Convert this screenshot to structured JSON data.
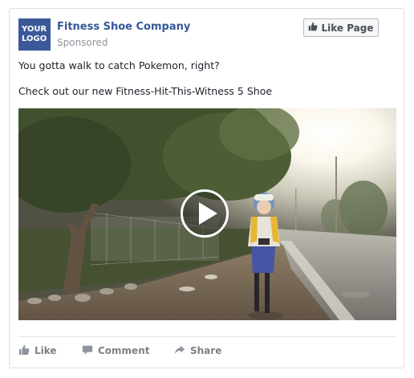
{
  "post": {
    "logo_line1": "YOUR",
    "logo_line2": "LOGO",
    "page_name": "Fitness Shoe Company",
    "sponsored": "Sponsored",
    "like_page": "Like Page",
    "text_line1": "You gotta walk to catch Pokemon, right?",
    "text_line2": "Check out our new Fitness-Hit-This-Witness 5 Shoe"
  },
  "actions": {
    "like": "Like",
    "comment": "Comment",
    "share": "Share"
  },
  "colors": {
    "brand_blue": "#3b5998",
    "link_blue": "#365899",
    "muted_gray": "#90949c",
    "action_gray": "#7f7f7f"
  },
  "icons": [
    "thumbs-up-icon",
    "play-icon",
    "comment-icon",
    "share-icon"
  ]
}
